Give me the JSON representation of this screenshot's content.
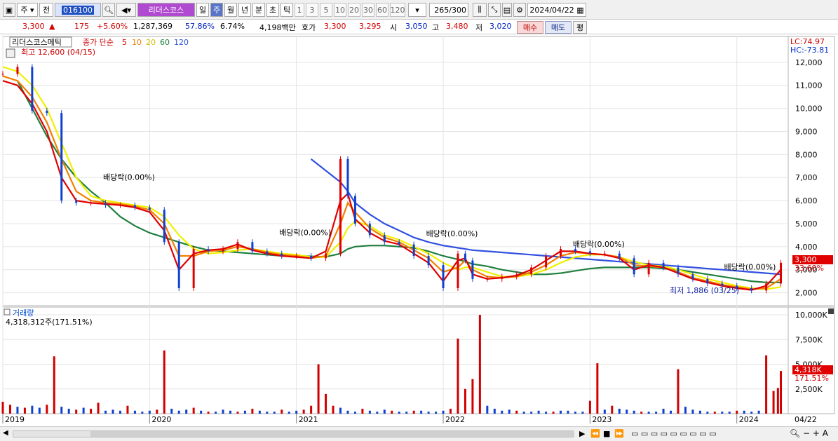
{
  "toolbar": {
    "period_main": "주",
    "prev_label": "전",
    "code_value": "016100",
    "stock_name": "리더스코스",
    "period_tabs": [
      "일",
      "주",
      "월",
      "년",
      "분",
      "초",
      "틱"
    ],
    "selected_period": "주",
    "interval_buttons": [
      "1",
      "3",
      "5",
      "10",
      "20",
      "30",
      "60",
      "120"
    ],
    "count_value": "265",
    "count_total": "/300",
    "date_value": "2024/04/22"
  },
  "info": {
    "price": "3,300",
    "change": "175",
    "change_pct": "+5.60%",
    "volume": "1,287,369",
    "turnover": "57.86%",
    "ratio": "6.74%",
    "amount": "4,198백만",
    "quote_label": "호가",
    "ask": "3,300",
    "bid": "3,295",
    "open_label": "시",
    "open": "3,050",
    "high_label": "고",
    "high": "3,480",
    "low_label": "저",
    "low": "3,020",
    "buy_label": "매수",
    "sell_label": "매도",
    "avg_label": "평"
  },
  "chart_data": [
    {
      "type": "candlestick",
      "title": "리더스코스메틱",
      "legend": {
        "label": "종가 단순",
        "periods": [
          "5",
          "10",
          "20",
          "60",
          "120"
        ]
      },
      "colors": {
        "ma5": "#e00000",
        "ma10": "#f08000",
        "ma20": "#f0f000",
        "ma60": "#208040",
        "ma120": "#3050e0",
        "up": "#e00000",
        "down": "#1040d0"
      },
      "y_axis": {
        "ticks": [
          "2,000",
          "3,000",
          "4,000",
          "5,000",
          "6,000",
          "7,000",
          "8,000",
          "9,000",
          "10,000",
          "11,000",
          "12,000"
        ],
        "range": [
          1500,
          13000
        ]
      },
      "x_axis": {
        "ticks": [
          "2019",
          "2020",
          "2021",
          "2022",
          "2023",
          "2024",
          "04/22"
        ]
      },
      "x": [
        2019.0,
        2019.1,
        2019.2,
        2019.3,
        2019.4,
        2019.5,
        2019.6,
        2019.7,
        2019.8,
        2019.9,
        2020.0,
        2020.1,
        2020.2,
        2020.3,
        2020.4,
        2020.5,
        2020.6,
        2020.7,
        2020.8,
        2020.9,
        2021.0,
        2021.1,
        2021.2,
        2021.3,
        2021.35,
        2021.4,
        2021.5,
        2021.6,
        2021.7,
        2021.8,
        2021.9,
        2022.0,
        2022.1,
        2022.15,
        2022.2,
        2022.3,
        2022.4,
        2022.5,
        2022.6,
        2022.7,
        2022.8,
        2022.9,
        2023.0,
        2023.1,
        2023.2,
        2023.3,
        2023.4,
        2023.5,
        2023.6,
        2023.7,
        2023.8,
        2023.9,
        2024.0,
        2024.1,
        2024.2,
        2024.3
      ],
      "close": [
        11500,
        11800,
        9900,
        9800,
        6000,
        5900,
        5900,
        5800,
        5800,
        5700,
        5600,
        4200,
        2200,
        3900,
        3800,
        3900,
        4200,
        3800,
        3700,
        3600,
        3600,
        3500,
        3700,
        7800,
        6200,
        5000,
        4500,
        4200,
        4100,
        3600,
        3200,
        2200,
        3700,
        3400,
        2600,
        2600,
        2700,
        2800,
        3100,
        3600,
        3900,
        3800,
        3700,
        3700,
        3500,
        2800,
        3300,
        3100,
        2800,
        2600,
        2400,
        2300,
        2200,
        2100,
        2400,
        3300
      ],
      "ma5": [
        11200,
        11000,
        10200,
        9000,
        7000,
        6000,
        5900,
        5850,
        5800,
        5700,
        5500,
        4700,
        3000,
        3700,
        3850,
        3900,
        4100,
        3850,
        3700,
        3600,
        3550,
        3500,
        3800,
        6000,
        6300,
        5200,
        4600,
        4250,
        4100,
        3700,
        3300,
        2500,
        3400,
        3500,
        2800,
        2600,
        2650,
        2750,
        3000,
        3400,
        3800,
        3800,
        3700,
        3650,
        3500,
        3000,
        3200,
        3100,
        2850,
        2600,
        2450,
        2300,
        2200,
        2120,
        2300,
        3000
      ],
      "ma10": [
        11400,
        11200,
        10500,
        9400,
        7800,
        6400,
        6000,
        5900,
        5850,
        5750,
        5600,
        5000,
        3600,
        3600,
        3800,
        3850,
        4000,
        3900,
        3750,
        3650,
        3600,
        3500,
        3600,
        5000,
        5900,
        5500,
        4800,
        4400,
        4200,
        3850,
        3500,
        2900,
        3100,
        3400,
        3000,
        2700,
        2650,
        2700,
        2900,
        3200,
        3600,
        3750,
        3700,
        3650,
        3550,
        3200,
        3150,
        3100,
        2900,
        2650,
        2500,
        2350,
        2250,
        2150,
        2200,
        2600
      ],
      "ma20": [
        11800,
        11600,
        11000,
        10000,
        8500,
        7000,
        6200,
        6000,
        5900,
        5800,
        5700,
        5300,
        4500,
        3900,
        3700,
        3750,
        3850,
        3900,
        3800,
        3700,
        3650,
        3550,
        3550,
        4200,
        4800,
        5100,
        4900,
        4500,
        4300,
        4000,
        3700,
        3300,
        3000,
        3100,
        3100,
        2900,
        2700,
        2700,
        2800,
        3000,
        3300,
        3550,
        3650,
        3650,
        3550,
        3350,
        3200,
        3150,
        3000,
        2800,
        2600,
        2450,
        2300,
        2200,
        2150,
        2250
      ],
      "ma60": [
        null,
        11200,
        10000,
        8800,
        7800,
        7000,
        6400,
        5900,
        5300,
        4900,
        4600,
        4400,
        4200,
        4000,
        3850,
        3800,
        3750,
        3700,
        3650,
        3600,
        3600,
        3580,
        3560,
        3700,
        3900,
        4000,
        4050,
        4050,
        4000,
        3950,
        3800,
        3600,
        3450,
        3350,
        3250,
        3150,
        3000,
        2900,
        2800,
        2800,
        2850,
        2950,
        3050,
        3100,
        3100,
        3100,
        3100,
        3050,
        3000,
        2900,
        2800,
        2700,
        2600,
        2500,
        2450,
        2450
      ],
      "ma120": [
        null,
        null,
        null,
        null,
        null,
        null,
        null,
        null,
        null,
        null,
        null,
        null,
        null,
        null,
        null,
        null,
        null,
        null,
        null,
        null,
        null,
        7800,
        7300,
        6800,
        6400,
        5900,
        5400,
        5000,
        4700,
        4400,
        4200,
        4050,
        3950,
        3900,
        3850,
        3800,
        3750,
        3700,
        3650,
        3600,
        3550,
        3500,
        3450,
        3400,
        3350,
        3300,
        3250,
        3200,
        3150,
        3100,
        3050,
        3000,
        2950,
        2900,
        2850,
        2800
      ],
      "annotations": [
        "배당락(0.00%)",
        "배당락(0.00%)",
        "배당락(0.00%)",
        "배당락(0.00%)",
        "배당락(0.00%)"
      ],
      "high_label": "최고 12,600 (04/15)",
      "low_label": "최저 1,886 (03/25)",
      "lc": "LC:74.97",
      "hc": "HC:-73.81",
      "current_price_tag": "3,300",
      "current_pct_tag": "33.60%"
    },
    {
      "type": "bar",
      "title": "거래량",
      "summary": "4,318,312주(171.51%)",
      "y_axis": {
        "ticks": [
          "2,500K",
          "5,000K",
          "7,500K",
          "10,000K"
        ],
        "range": [
          0,
          10500
        ]
      },
      "current_tag": "4,318K",
      "current_pct_tag": "171.51%",
      "x": [
        2019.0,
        2019.05,
        2019.1,
        2019.15,
        2019.2,
        2019.25,
        2019.3,
        2019.35,
        2019.4,
        2019.45,
        2019.5,
        2019.55,
        2019.6,
        2019.65,
        2019.7,
        2019.75,
        2019.8,
        2019.85,
        2019.9,
        2019.95,
        2020.0,
        2020.05,
        2020.1,
        2020.15,
        2020.2,
        2020.25,
        2020.3,
        2020.35,
        2020.4,
        2020.45,
        2020.5,
        2020.55,
        2020.6,
        2020.65,
        2020.7,
        2020.75,
        2020.8,
        2020.85,
        2020.9,
        2020.95,
        2021.0,
        2021.05,
        2021.1,
        2021.15,
        2021.2,
        2021.25,
        2021.3,
        2021.35,
        2021.4,
        2021.45,
        2021.5,
        2021.55,
        2021.6,
        2021.65,
        2021.7,
        2021.75,
        2021.8,
        2021.85,
        2021.9,
        2021.95,
        2022.0,
        2022.05,
        2022.1,
        2022.15,
        2022.2,
        2022.25,
        2022.3,
        2022.35,
        2022.4,
        2022.45,
        2022.5,
        2022.55,
        2022.6,
        2022.65,
        2022.7,
        2022.75,
        2022.8,
        2022.85,
        2022.9,
        2022.95,
        2023.0,
        2023.05,
        2023.1,
        2023.15,
        2023.2,
        2023.25,
        2023.3,
        2023.35,
        2023.4,
        2023.45,
        2023.5,
        2023.55,
        2023.6,
        2023.65,
        2023.7,
        2023.75,
        2023.8,
        2023.85,
        2023.9,
        2023.95,
        2024.0,
        2024.05,
        2024.1,
        2024.15,
        2024.2,
        2024.25,
        2024.28,
        2024.3
      ],
      "values": [
        1200,
        900,
        700,
        600,
        800,
        600,
        900,
        5800,
        700,
        500,
        400,
        600,
        500,
        1100,
        300,
        400,
        300,
        800,
        300,
        200,
        300,
        400,
        6400,
        500,
        300,
        400,
        600,
        300,
        200,
        200,
        400,
        300,
        200,
        300,
        500,
        300,
        200,
        200,
        400,
        200,
        300,
        400,
        800,
        5000,
        2000,
        800,
        600,
        300,
        200,
        500,
        300,
        200,
        400,
        300,
        200,
        200,
        300,
        300,
        200,
        200,
        300,
        500,
        7600,
        2500,
        3500,
        10000,
        800,
        500,
        300,
        400,
        300,
        200,
        200,
        300,
        200,
        200,
        300,
        300,
        200,
        200,
        1300,
        5100,
        400,
        800,
        500,
        400,
        300,
        200,
        200,
        200,
        500,
        300,
        4500,
        700,
        400,
        300,
        200,
        200,
        200,
        200,
        300,
        300,
        200,
        300,
        5900,
        2300,
        2600,
        4318
      ],
      "up": [
        true,
        true,
        false,
        true,
        false,
        false,
        true,
        true,
        false,
        false,
        true,
        false,
        true,
        true,
        false,
        false,
        false,
        true,
        false,
        false,
        false,
        true,
        true,
        false,
        false,
        false,
        true,
        false,
        true,
        false,
        false,
        false,
        true,
        false,
        true,
        false,
        false,
        false,
        true,
        false,
        false,
        true,
        true,
        true,
        true,
        true,
        false,
        false,
        false,
        true,
        false,
        false,
        false,
        true,
        false,
        false,
        true,
        false,
        false,
        false,
        false,
        true,
        true,
        true,
        true,
        true,
        false,
        false,
        false,
        false,
        true,
        false,
        false,
        false,
        false,
        true,
        false,
        false,
        false,
        false,
        true,
        true,
        false,
        true,
        false,
        false,
        false,
        true,
        false,
        false,
        false,
        false,
        true,
        false,
        false,
        false,
        false,
        true,
        false,
        false,
        true,
        false,
        false,
        false,
        true,
        true,
        true,
        true
      ]
    }
  ],
  "bottom": {
    "date_label": "04/22"
  }
}
